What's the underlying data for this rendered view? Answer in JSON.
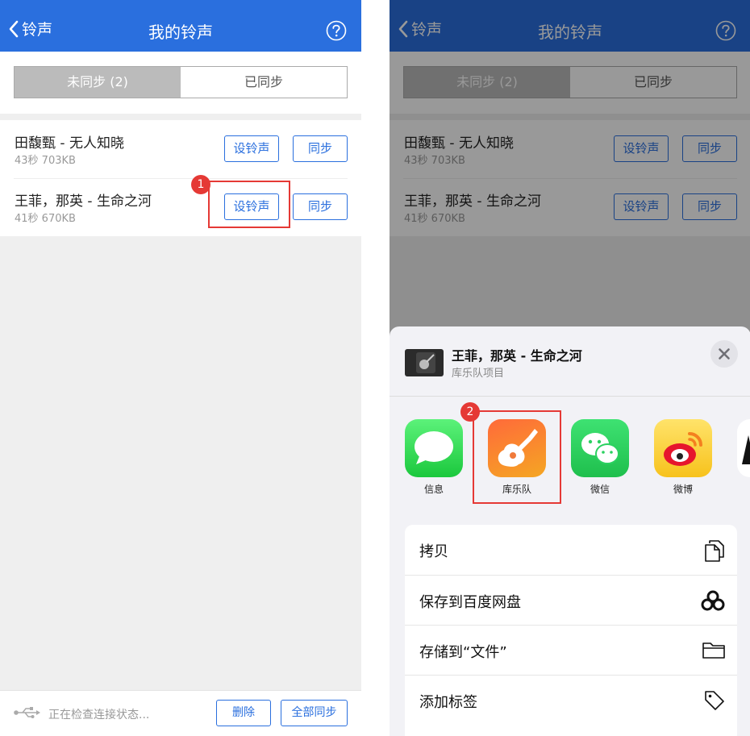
{
  "header": {
    "back_label": "铃声",
    "title": "我的铃声"
  },
  "tabs": [
    {
      "label": "未同步 (2)",
      "active": true
    },
    {
      "label": "已同步",
      "active": false
    }
  ],
  "songs": [
    {
      "name": "田馥甄 - 无人知晓",
      "meta": "43秒  703KB",
      "set_label": "设铃声",
      "sync_label": "同步"
    },
    {
      "name": "王菲，那英 - 生命之河",
      "meta": "41秒  670KB",
      "set_label": "设铃声",
      "sync_label": "同步"
    }
  ],
  "footer": {
    "status": "正在检查连接状态...",
    "delete_label": "删除",
    "sync_all_label": "全部同步"
  },
  "annotations": {
    "step1": "1",
    "step2": "2"
  },
  "share_sheet": {
    "title": "王菲，那英 - 生命之河",
    "subtitle": "库乐队项目",
    "apps": [
      {
        "label": "信息",
        "icon": "messages-icon"
      },
      {
        "label": "库乐队",
        "icon": "garageband-icon"
      },
      {
        "label": "微信",
        "icon": "wechat-icon"
      },
      {
        "label": "微博",
        "icon": "weibo-icon"
      }
    ],
    "actions": [
      {
        "label": "拷贝",
        "icon": "copy-icon"
      },
      {
        "label": "保存到百度网盘",
        "icon": "baidu-netdisk-icon"
      },
      {
        "label": "存储到“文件”",
        "icon": "folder-icon"
      },
      {
        "label": "添加标签",
        "icon": "tag-icon"
      }
    ]
  },
  "colors": {
    "header_blue": "#2a6fde",
    "annotation_red": "#e53935"
  }
}
